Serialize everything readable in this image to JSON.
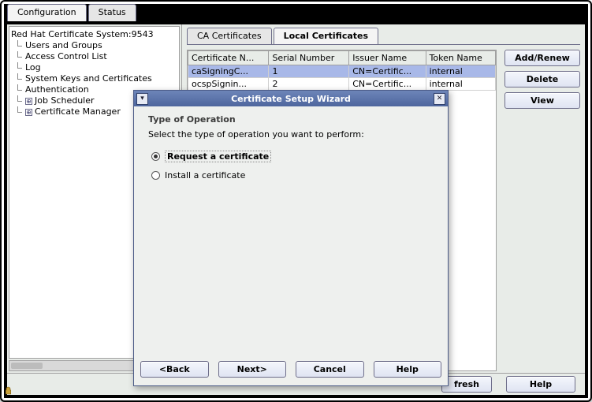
{
  "outerTabs": {
    "configuration": "Configuration",
    "status": "Status"
  },
  "tree": {
    "root": "Red Hat Certificate System:9543",
    "items": [
      "Users and Groups",
      "Access Control List",
      "Log",
      "System Keys and Certificates",
      "Authentication"
    ],
    "expandable": [
      "Job Scheduler",
      "Certificate Manager"
    ]
  },
  "innerTabs": {
    "ca": "CA Certificates",
    "local": "Local Certificates"
  },
  "table": {
    "headers": [
      "Certificate N...",
      "Serial Number",
      "Issuer Name",
      "Token Name"
    ],
    "rows": [
      [
        "caSigningC...",
        "1",
        "CN=Certific...",
        "internal"
      ],
      [
        "ocspSignin...",
        "2",
        "CN=Certific...",
        "internal"
      ]
    ]
  },
  "buttons": {
    "addRenew": "Add/Renew",
    "delete": "Delete",
    "view": "View",
    "refresh": "fresh",
    "help": "Help"
  },
  "wizard": {
    "title": "Certificate Setup Wizard",
    "heading": "Type of Operation",
    "instruction": "Select the type of operation you want to perform:",
    "optRequest": "Request a certificate",
    "optInstall": "Install a certificate",
    "back": "<Back",
    "next": "Next>",
    "cancel": "Cancel",
    "help": "Help"
  }
}
